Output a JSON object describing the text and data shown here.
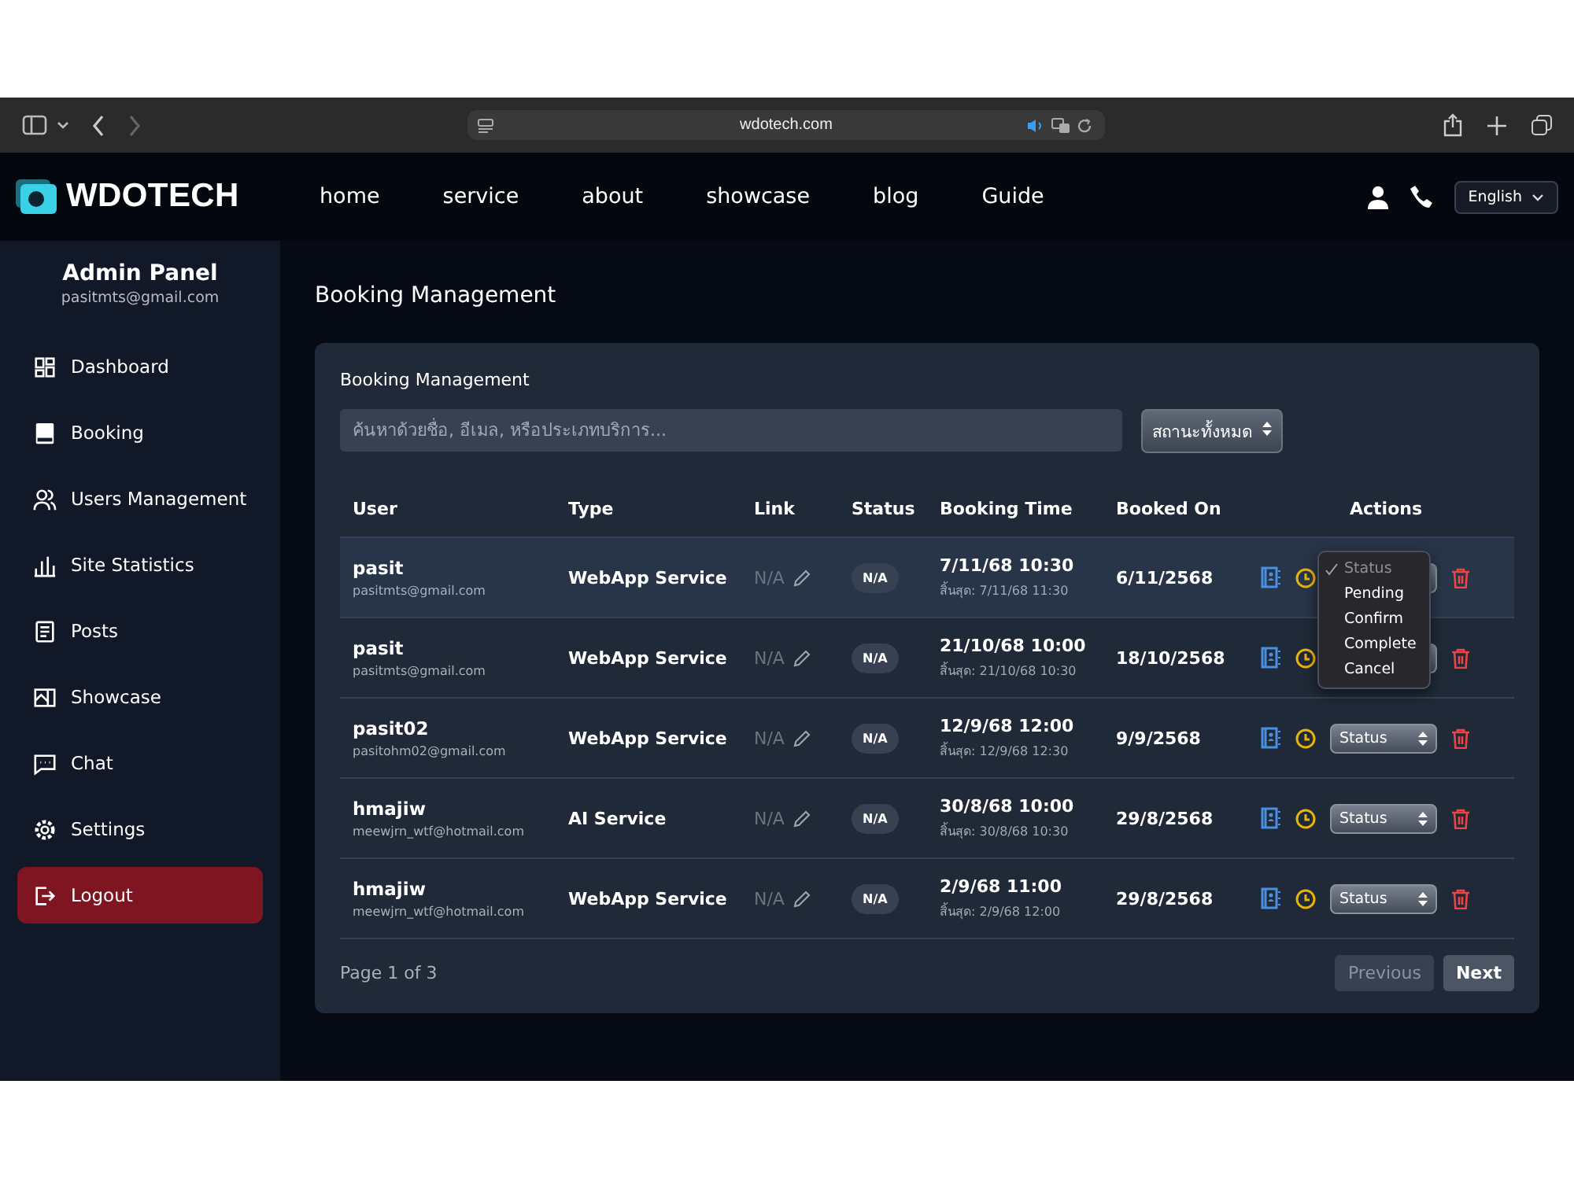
{
  "browser": {
    "url": "wdotech.com"
  },
  "site": {
    "logo": "WDOTECH",
    "nav": [
      "home",
      "service",
      "about",
      "showcase",
      "blog",
      "Guide"
    ],
    "language": "English"
  },
  "sidebar": {
    "title": "Admin Panel",
    "email": "pasitmts@gmail.com",
    "items": [
      {
        "label": "Dashboard",
        "kind": "nav"
      },
      {
        "label": "Booking",
        "kind": "nav"
      },
      {
        "label": "Users Management",
        "kind": "nav"
      },
      {
        "label": "Site Statistics",
        "kind": "nav"
      },
      {
        "label": "Posts",
        "kind": "nav"
      },
      {
        "label": "Showcase",
        "kind": "nav"
      },
      {
        "label": "Chat",
        "kind": "nav"
      },
      {
        "label": "Settings",
        "kind": "nav"
      },
      {
        "label": "Logout",
        "kind": "logout"
      }
    ]
  },
  "page_title": "Booking Management",
  "card": {
    "title": "Booking Management",
    "search": {
      "placeholder": "ค้นหาด้วยชื่อ, อีเมล, หรือประเภทบริการ..."
    },
    "status_filter": "สถานะทั้งหมด",
    "table": {
      "columns": [
        "User",
        "Type",
        "Link",
        "Status",
        "Booking Time",
        "Booked On",
        "Actions"
      ],
      "rows": [
        {
          "user": "pasit",
          "email": "pasitmts@gmail.com",
          "type": "WebApp Service",
          "link": "N/A",
          "status": "N/A",
          "time": "7/11/68 10:30",
          "end": "สิ้นสุด: 7/11/68 11:30",
          "booked": "6/11/2568",
          "hovered": true,
          "menu": [
            {
              "label": "Status",
              "selected": true,
              "disabled": true
            },
            {
              "label": "Pending",
              "selected": false,
              "disabled": false
            },
            {
              "label": "Confirm",
              "selected": false,
              "disabled": false
            },
            {
              "label": "Complete",
              "selected": false,
              "disabled": false
            },
            {
              "label": "Cancel",
              "selected": false,
              "disabled": false
            }
          ]
        },
        {
          "user": "pasit",
          "email": "pasitmts@gmail.com",
          "type": "WebApp Service",
          "link": "N/A",
          "status": "N/A",
          "time": "21/10/68 10:00",
          "end": "สิ้นสุด: 21/10/68 10:30",
          "booked": "18/10/2568",
          "hovered": false
        },
        {
          "user": "pasit02",
          "email": "pasitohm02@gmail.com",
          "type": "WebApp Service",
          "link": "N/A",
          "status": "N/A",
          "time": "12/9/68 12:00",
          "end": "สิ้นสุด: 12/9/68 12:30",
          "booked": "9/9/2568",
          "hovered": false,
          "select": "Status"
        },
        {
          "user": "hmajiw",
          "email": "meewjrn_wtf@hotmail.com",
          "type": "AI Service",
          "link": "N/A",
          "status": "N/A",
          "time": "30/8/68 10:00",
          "end": "สิ้นสุด: 30/8/68 10:30",
          "booked": "29/8/2568",
          "hovered": false,
          "select": "Status"
        },
        {
          "user": "hmajiw",
          "email": "meewjrn_wtf@hotmail.com",
          "type": "WebApp Service",
          "link": "N/A",
          "status": "N/A",
          "time": "2/9/68 11:00",
          "end": "สิ้นสุด: 2/9/68 12:00",
          "booked": "29/8/2568",
          "hovered": false,
          "select": "Status"
        }
      ]
    },
    "pagination": {
      "info": "Page 1 of 3",
      "buttons": [
        {
          "label": "Previous",
          "disabled": true
        },
        {
          "label": "Next",
          "disabled": false
        }
      ]
    }
  }
}
